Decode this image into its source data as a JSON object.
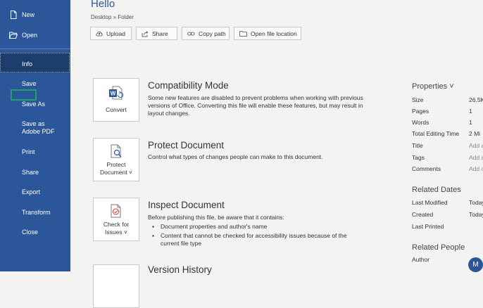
{
  "sidebar": {
    "items": [
      {
        "label": "New",
        "icon": "new-document-icon"
      },
      {
        "label": "Open",
        "icon": "folder-open-icon"
      },
      {
        "label": "Info"
      },
      {
        "label": "Save"
      },
      {
        "label": "Save As"
      },
      {
        "label": "Save as Adobe PDF"
      },
      {
        "label": "Print"
      },
      {
        "label": "Share"
      },
      {
        "label": "Export"
      },
      {
        "label": "Transform"
      },
      {
        "label": "Close"
      }
    ]
  },
  "header": {
    "title": "Hello",
    "path": "Desktop » Folder",
    "buttons": [
      {
        "label": "Upload",
        "icon": "upload-icon"
      },
      {
        "label": "Share",
        "icon": "share-icon"
      },
      {
        "label": "Copy path",
        "icon": "link-icon"
      },
      {
        "label": "Open file location",
        "icon": "folder-icon"
      }
    ]
  },
  "sections": {
    "compatibility": {
      "tile_label": "Convert",
      "title": "Compatibility Mode",
      "desc": "Some new features are disabled to prevent problems when working with previous versions of Office. Converting this file will enable these features, but may result in layout changes."
    },
    "protect": {
      "tile_label_1": "Protect",
      "tile_label_2": "Document ˅",
      "title": "Protect Document",
      "desc": "Control what types of changes people can make to this document."
    },
    "inspect": {
      "tile_label_1": "Check for",
      "tile_label_2": "Issues ˅",
      "title": "Inspect Document",
      "desc": "Before publishing this file, be aware that it contains:",
      "bullets": [
        "Document properties and author's name",
        "Content that cannot be checked for accessibility issues because of the current file type"
      ]
    },
    "version": {
      "title": "Version History"
    }
  },
  "properties": {
    "heading": "Properties ˅",
    "rows": [
      {
        "key": "Size",
        "value": "26.5K"
      },
      {
        "key": "Pages",
        "value": "1"
      },
      {
        "key": "Words",
        "value": "1"
      },
      {
        "key": "Total Editing Time",
        "value": "2 Mi"
      },
      {
        "key": "Title",
        "value": "Add a"
      },
      {
        "key": "Tags",
        "value": "Add a"
      },
      {
        "key": "Comments",
        "value": "Add c"
      }
    ],
    "related_dates": {
      "heading": "Related Dates",
      "rows": [
        {
          "key": "Last Modified",
          "value": "Today"
        },
        {
          "key": "Created",
          "value": "Today"
        },
        {
          "key": "Last Printed",
          "value": ""
        }
      ]
    },
    "related_people": {
      "heading": "Related People",
      "author_key": "Author",
      "avatar_initial": "M"
    }
  },
  "colors": {
    "sidebar": "#2b579a",
    "sidebar_selected": "#1d3e6d",
    "focus": "#21a366",
    "accent": "#2b579a"
  }
}
